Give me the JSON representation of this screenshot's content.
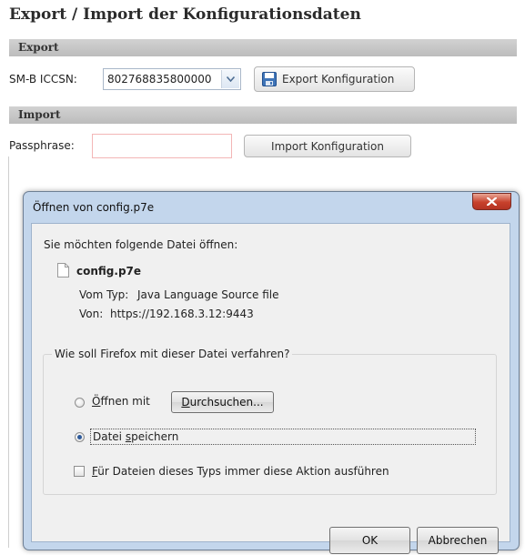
{
  "page": {
    "title": "Export / Import der Konfigurationsdaten"
  },
  "export_section": {
    "heading": "Export",
    "iccsn_label": "SM-B ICCSN:",
    "iccsn_value": "802768835800000",
    "export_button": "Export Konfiguration"
  },
  "import_section": {
    "heading": "Import",
    "passphrase_label": "Passphrase:",
    "passphrase_value": "",
    "import_button": "Import Konfiguration"
  },
  "dialog": {
    "title": "Öffnen von config.p7e",
    "intro": "Sie möchten folgende Datei öffnen:",
    "file_name": "config.p7e",
    "type_label": "Vom Typ:",
    "type_value": "Java Language Source file",
    "from_label": "Von:",
    "from_value": "https://192.168.3.12:9443",
    "question": "Wie soll Firefox mit dieser Datei verfahren?",
    "open_with_label": "Öffnen mit",
    "browse_button": "Durchsuchen...",
    "save_file_label": "Datei speichern",
    "always_label": "Für Dateien dieses Typs immer diese Aktion ausführen",
    "ok_button": "OK",
    "cancel_button": "Abbrechen",
    "selected_option": "save_file",
    "always_checked": false
  },
  "colors": {
    "section_bar": "#c6c6c6",
    "dialog_frame": "#c3d6ec",
    "close_button": "#c7412c",
    "passphrase_border": "#f3b6b6"
  }
}
